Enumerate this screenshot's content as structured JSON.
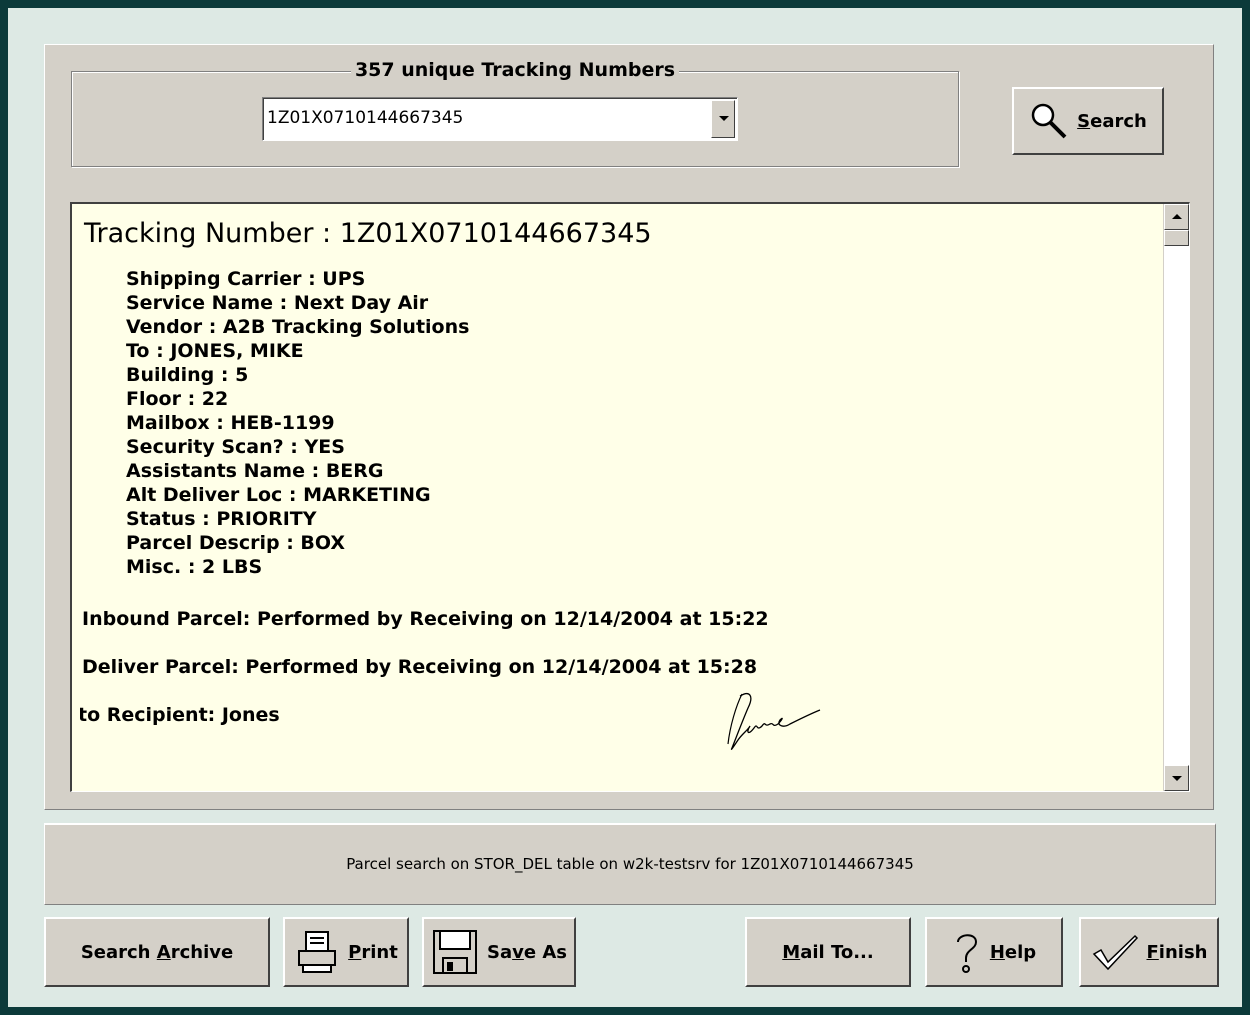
{
  "search_group": {
    "legend": "357 unique Tracking Numbers",
    "tracking_select_value": "1Z01X0710144667345",
    "search_button": {
      "mnemonic": "S",
      "rest": "earch",
      "icon": "magnifier-icon"
    }
  },
  "details": {
    "heading": "Tracking Number : 1Z01X0710144667345",
    "fields": [
      "Shipping Carrier : UPS",
      "Service Name : Next Day Air",
      "Vendor : A2B Tracking Solutions",
      "To : JONES, MIKE",
      "Building : 5",
      "Floor : 22",
      "Mailbox : HEB-1199",
      "Security Scan? : YES",
      "Assistants Name : BERG",
      "Alt Deliver Loc : MARKETING",
      "Status : PRIORITY",
      "Parcel Descrip : BOX",
      "Misc. : 2 LBS"
    ],
    "inbound": "Inbound Parcel: Performed by Receiving on 12/14/2004 at 15:22",
    "deliver": "Deliver Parcel: Performed by Receiving on 12/14/2004 at 15:28",
    "recipient": "to Recipient: Jones",
    "signature_name": "Jones"
  },
  "status_bar": {
    "text": "Parcel search on STOR_DEL table on w2k-testsrv for 1Z01X0710144667345"
  },
  "buttons": {
    "search_archive": {
      "pre": "Search ",
      "mnemonic": "A",
      "rest": "rchive"
    },
    "print": {
      "mnemonic": "P",
      "rest": "rint",
      "icon": "printer-icon"
    },
    "save_as": {
      "pre": "Sa",
      "mnemonic": "v",
      "rest": "e As",
      "icon": "floppy-disk-icon"
    },
    "mail_to": {
      "mnemonic": "M",
      "rest": "ail To..."
    },
    "help": {
      "mnemonic": "H",
      "rest": "elp",
      "icon": "question-mark-icon"
    },
    "finish": {
      "mnemonic": "F",
      "rest": "inish",
      "icon": "checkmark-icon"
    }
  }
}
